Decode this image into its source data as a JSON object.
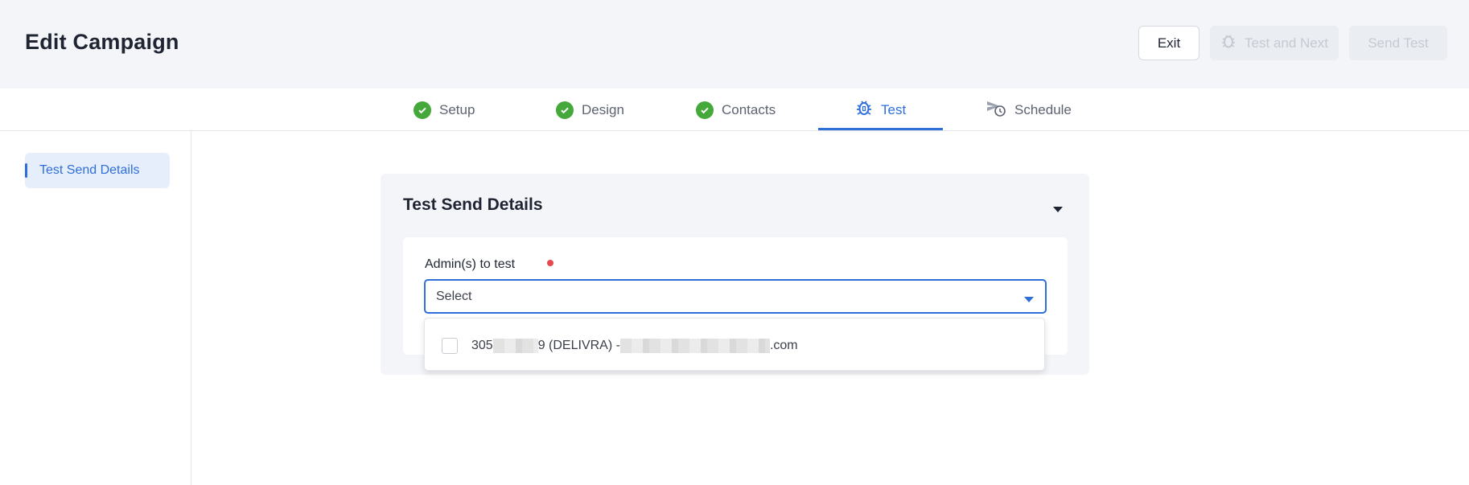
{
  "header": {
    "title": "Edit Campaign",
    "exit_label": "Exit",
    "test_next_label": "Test and Next",
    "send_test_label": "Send Test"
  },
  "steps": [
    {
      "label": "Setup",
      "icon": "check-circle-icon",
      "state": "done"
    },
    {
      "label": "Design",
      "icon": "check-circle-icon",
      "state": "done"
    },
    {
      "label": "Contacts",
      "icon": "check-circle-icon",
      "state": "done"
    },
    {
      "label": "Test",
      "icon": "bug-icon",
      "state": "active"
    },
    {
      "label": "Schedule",
      "icon": "schedule-send-icon",
      "state": "pending"
    }
  ],
  "sidebar": {
    "items": [
      {
        "label": "Test Send Details",
        "selected": true
      }
    ]
  },
  "panel": {
    "title": "Test Send Details",
    "field_label": "Admin(s) to test",
    "select_placeholder": "Select",
    "options": [
      {
        "prefix": "305",
        "middle": "9 (DELIVRA) - ",
        "suffix": ".com",
        "checked": false
      }
    ]
  },
  "colors": {
    "accent": "#2f6fd9",
    "success": "#45a83a",
    "required": "#e5484d",
    "header_bg": "#f4f5f8"
  }
}
